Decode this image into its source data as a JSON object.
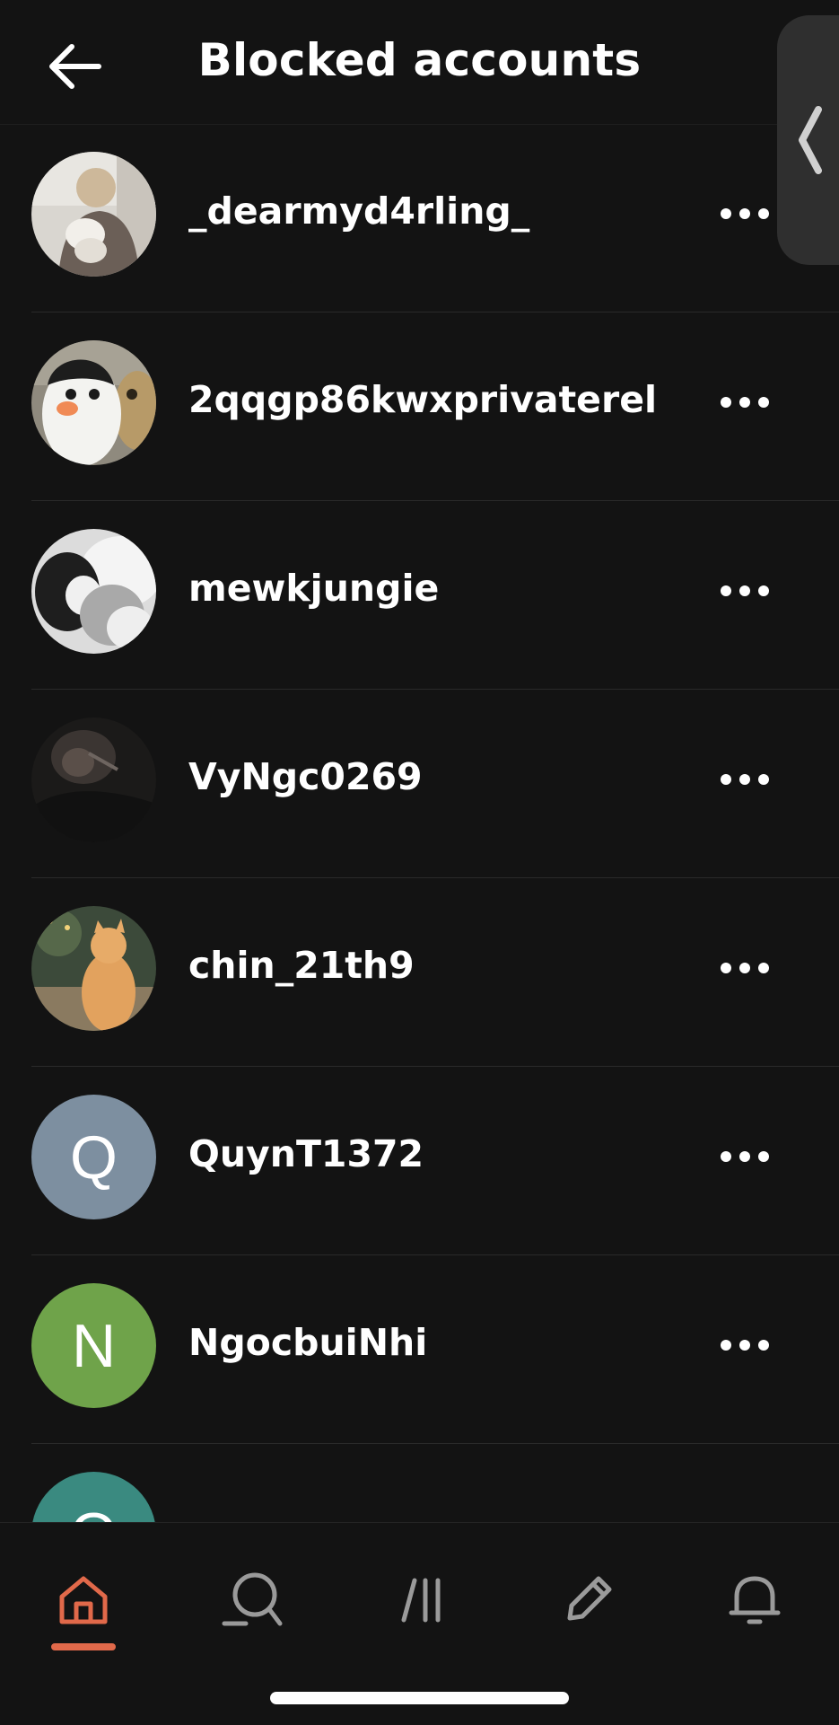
{
  "header": {
    "title": "Blocked accounts",
    "back_icon": "arrow-left-icon"
  },
  "edge_panel": {
    "icon": "chevron-left-icon"
  },
  "accounts": [
    {
      "username": "_dearmyd4rling_",
      "avatar": "photo-person-holding-cat"
    },
    {
      "username": "2qqgp86kwxprivaterel",
      "avatar": "photo-penguin-plush"
    },
    {
      "username": "mewkjungie",
      "avatar": "photo-black-white-cat"
    },
    {
      "username": "VyNgc0269",
      "avatar": "photo-dark-portrait"
    },
    {
      "username": "chin_21th9",
      "avatar": "photo-orange-cat"
    },
    {
      "username": "QuynT1372",
      "avatar_letter": "Q",
      "avatar_color": "#7d8fa0"
    },
    {
      "username": "NgocbuiNhi",
      "avatar_letter": "N",
      "avatar_color": "#6fa34a"
    },
    {
      "username": "",
      "avatar_letter": "O",
      "avatar_color": "#3a8a80"
    }
  ],
  "bottom_nav": {
    "items": [
      "home-icon",
      "search-icon",
      "feed-icon",
      "compose-icon",
      "notifications-icon"
    ],
    "active": "home-icon"
  },
  "colors": {
    "background": "#131313",
    "accent": "#e1694a",
    "text": "#ffffff",
    "icon_inactive": "#9a9a9a"
  }
}
